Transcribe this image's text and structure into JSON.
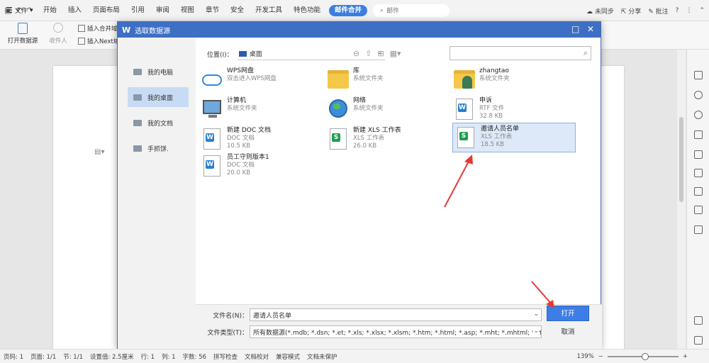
{
  "menubar": {
    "file_label": "文件",
    "tabs": [
      "开始",
      "插入",
      "页面布局",
      "引用",
      "审阅",
      "视图",
      "章节",
      "安全",
      "开发工具",
      "特色功能"
    ],
    "active_tab": "邮件合并",
    "search_label": "邮件",
    "sync": "未同步",
    "share": "分享",
    "annotate": "批注"
  },
  "ribbon": {
    "open_source": "打开数据源",
    "recipients": "收件人",
    "insert_field": "插入合并域",
    "insert_next": "插入Next域"
  },
  "dialog": {
    "title": "选取数据源",
    "sidebar": [
      "我的电脑",
      "我的桌面",
      "我的文档",
      "手抓饼."
    ],
    "location_label": "位置(I)：",
    "location_value": "桌面",
    "files": [
      {
        "name": "WPS网盘",
        "meta1": "双击进入WPS网盘",
        "meta2": "",
        "meta3": ""
      },
      {
        "name": "库",
        "meta1": "系统文件夹",
        "meta2": "",
        "meta3": ""
      },
      {
        "name": "zhangtao",
        "meta1": "系统文件夹",
        "meta2": "",
        "meta3": ""
      },
      {
        "name": "计算机",
        "meta1": "系统文件夹",
        "meta2": "",
        "meta3": ""
      },
      {
        "name": "网络",
        "meta1": "系统文件夹",
        "meta2": "",
        "meta3": ""
      },
      {
        "name": "申诉",
        "meta1": "RTF 文件",
        "meta2": "32.8 KB",
        "meta3": ""
      },
      {
        "name": "新建 DOC 文档",
        "meta1": "DOC 文档",
        "meta2": "10.5 KB",
        "meta3": ""
      },
      {
        "name": "新建 XLS 工作表",
        "meta1": "XLS 工作表",
        "meta2": "26.0 KB",
        "meta3": ""
      },
      {
        "name": "邀请人员名单",
        "meta1": "XLS 工作表",
        "meta2": "18.5 KB",
        "meta3": ""
      },
      {
        "name": "员工守则版本1",
        "meta1": "DOC 文档",
        "meta2": "20.0 KB",
        "meta3": ""
      }
    ],
    "filename_label": "文件名(N)：",
    "filename_value": "邀请人员名单",
    "filetype_label": "文件类型(T)：",
    "filetype_value": "所有数据源(*.mdb; *.dsn; *.et; *.xls; *.xlsx; *.xlsm; *.htm; *.html; *.asp; *.mht; *.mhtml; *.rtf; *.docx; *.doc",
    "ok": "打开",
    "cancel": "取消"
  },
  "statusbar": {
    "items": [
      "页码: 1",
      "页面: 1/1",
      "节: 1/1",
      "设置值: 2.5厘米",
      "行: 1",
      "列: 1",
      "字数: 56",
      "拼写检查",
      "文档校对",
      "兼容模式",
      "文档未保护"
    ],
    "zoom": "139%"
  },
  "colors": {
    "accent": "#3d6fc4",
    "active_tab": "#3c7ee0",
    "selection": "#dde9f8",
    "arrow": "#e53935"
  }
}
